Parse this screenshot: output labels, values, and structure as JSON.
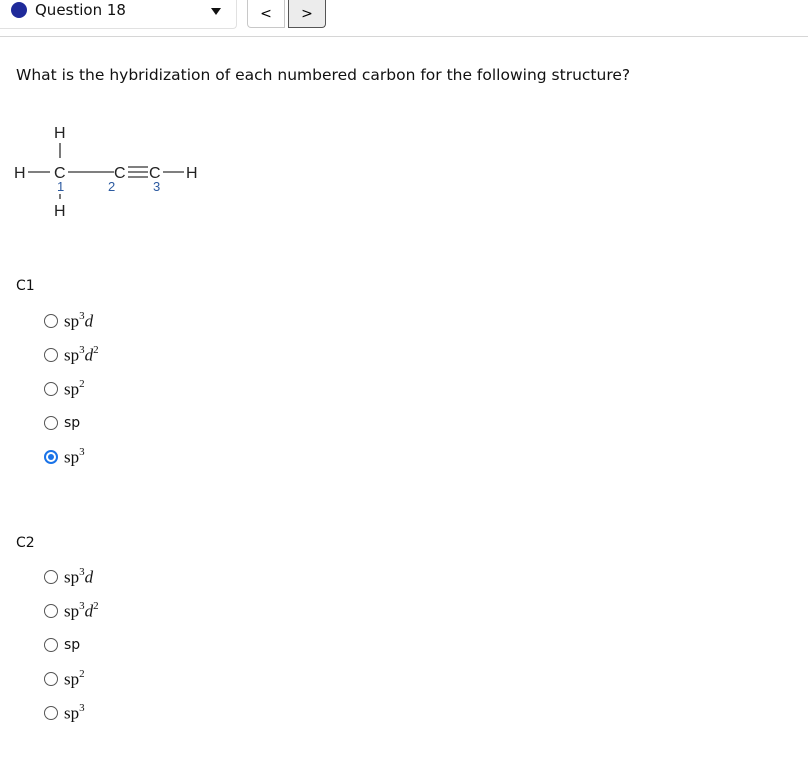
{
  "header": {
    "question_label": "Question 18",
    "prev_label": "<",
    "next_label": ">"
  },
  "question_text": "What is the hybridization of each numbered carbon for the following structure?",
  "structure": {
    "atoms": {
      "h_top": "H",
      "h_left": "H",
      "c1": "C",
      "h_bottom": "H",
      "c2": "C",
      "c3": "C",
      "h_right": "H"
    },
    "numbers": {
      "n1": "1",
      "n2": "2",
      "n3": "3"
    }
  },
  "groups": [
    {
      "label": "C1",
      "options": [
        {
          "base": "sp",
          "sup1": "3",
          "d": "d",
          "sup2": "",
          "selected": false
        },
        {
          "base": "sp",
          "sup1": "3",
          "d": "d",
          "sup2": "2",
          "selected": false
        },
        {
          "base": "sp",
          "sup1": "2",
          "d": "",
          "sup2": "",
          "selected": false
        },
        {
          "base": "sp",
          "sup1": "",
          "d": "",
          "sup2": "",
          "selected": false,
          "plain": true
        },
        {
          "base": "sp",
          "sup1": "3",
          "d": "",
          "sup2": "",
          "selected": true
        }
      ]
    },
    {
      "label": "C2",
      "options": [
        {
          "base": "sp",
          "sup1": "3",
          "d": "d",
          "sup2": "",
          "selected": false
        },
        {
          "base": "sp",
          "sup1": "3",
          "d": "d",
          "sup2": "2",
          "selected": false
        },
        {
          "base": "sp",
          "sup1": "",
          "d": "",
          "sup2": "",
          "selected": false,
          "plain": true
        },
        {
          "base": "sp",
          "sup1": "2",
          "d": "",
          "sup2": "",
          "selected": false
        },
        {
          "base": "sp",
          "sup1": "3",
          "d": "",
          "sup2": "",
          "selected": false
        }
      ]
    }
  ],
  "colors": {
    "accent": "#1a73e8",
    "question_dot": "#1f2a9a",
    "number_color": "#2c5aa0"
  }
}
